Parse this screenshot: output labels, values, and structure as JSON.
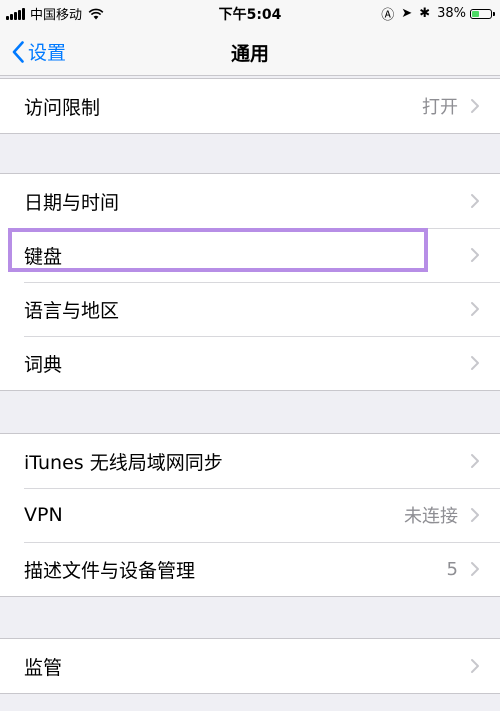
{
  "status_bar": {
    "carrier": "中国移动",
    "time": "下午5:04",
    "battery_percent": "38%",
    "battery_level": 0.38,
    "icons": [
      "signal-icon",
      "wifi-icon",
      "location-lock-icon",
      "location-icon",
      "bluetooth-icon",
      "battery-icon"
    ]
  },
  "nav": {
    "back_label": "设置",
    "title": "通用"
  },
  "groups": [
    {
      "rows": [
        {
          "label": "访问限制",
          "detail": "打开"
        }
      ]
    },
    {
      "rows": [
        {
          "label": "日期与时间",
          "detail": ""
        },
        {
          "label": "键盘",
          "detail": ""
        },
        {
          "label": "语言与地区",
          "detail": ""
        },
        {
          "label": "词典",
          "detail": ""
        }
      ]
    },
    {
      "rows": [
        {
          "label": "iTunes 无线局域网同步",
          "detail": ""
        },
        {
          "label": "VPN",
          "detail": "未连接"
        },
        {
          "label": "描述文件与设备管理",
          "detail": "5"
        }
      ]
    },
    {
      "rows": [
        {
          "label": "监管",
          "detail": ""
        }
      ]
    }
  ],
  "colors": {
    "accent": "#007aff",
    "highlight": "#b78ee6",
    "battery": "#4cd964",
    "background": "#efeff4"
  }
}
